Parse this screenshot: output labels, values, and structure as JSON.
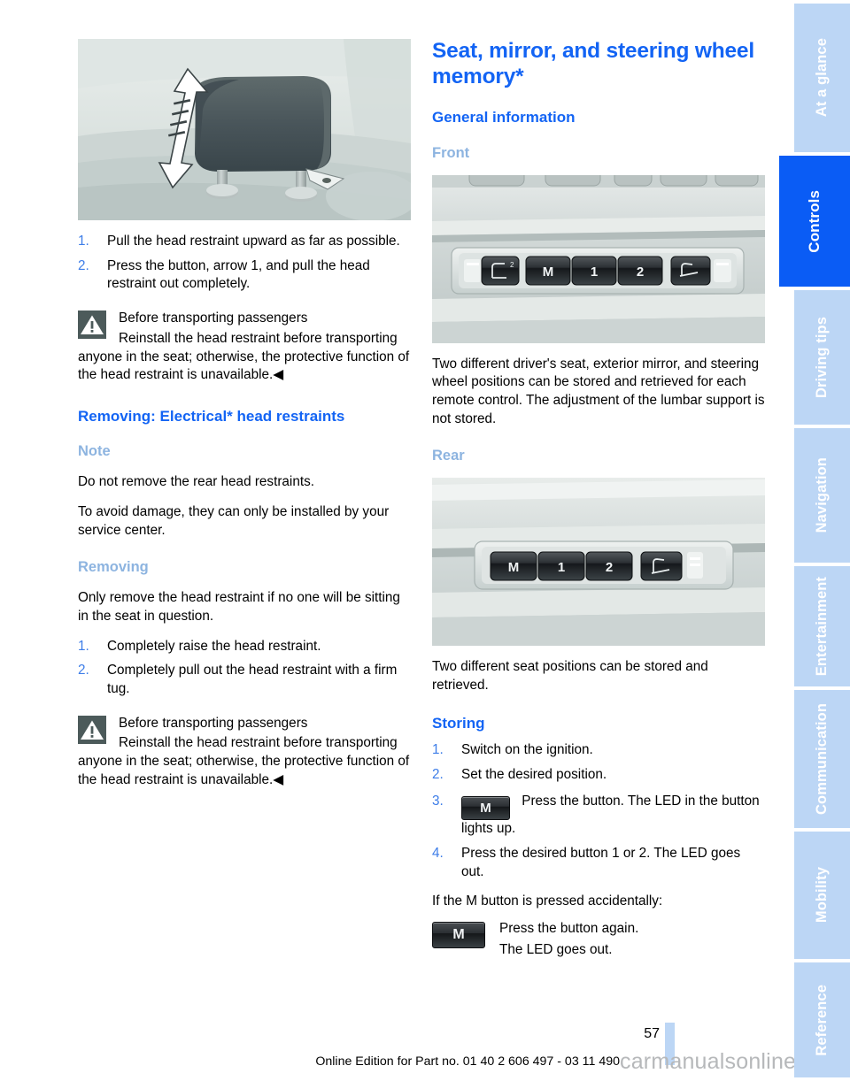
{
  "document": {
    "page_number": "57",
    "footer_note": "Online Edition for Part no. 01 40 2 606 497 - 03 11 490",
    "watermark": "carmanualsonline.info"
  },
  "colors": {
    "heading_blue": "#1364f4",
    "subheading_blue": "#8db4e0",
    "tab_active": "#0a5cf5",
    "tab_inactive": "#bcd6f5",
    "step_number": "#3d7de8",
    "warning_box": "#4c5a5a"
  },
  "sidebar": {
    "tabs": [
      {
        "label": "At a glance",
        "active": false
      },
      {
        "label": "Controls",
        "active": true
      },
      {
        "label": "Driving tips",
        "active": false
      },
      {
        "label": "Navigation",
        "active": false
      },
      {
        "label": "Entertainment",
        "active": false
      },
      {
        "label": "Communication",
        "active": false
      },
      {
        "label": "Mobility",
        "active": false
      },
      {
        "label": "Reference",
        "active": false
      }
    ]
  },
  "left_column": {
    "figure_caption": "Head restraint with up and down adjustment arrow",
    "steps_1": [
      {
        "num": "1.",
        "text": "Pull the head restraint upward as far as pos­sible."
      },
      {
        "num": "2.",
        "text": "Press the button, arrow 1, and pull the head restraint out completely."
      }
    ],
    "warning_1": {
      "title": "Before transporting passengers",
      "body": "Reinstall the head restraint before trans­porting anyone in the seat; otherwise, the pro­tective function of the head restraint is unavail­able.◀"
    },
    "heading_removing_electrical": "Removing: Electrical* head restraints",
    "subheading_note": "Note",
    "note_p1": "Do not remove the rear head restraints.",
    "note_p2": "To avoid damage, they can only be installed by your service center.",
    "subheading_removing": "Removing",
    "removing_intro": "Only remove the head restraint if no one will be sitting in the seat in question.",
    "steps_2": [
      {
        "num": "1.",
        "text": "Completely raise the head restraint."
      },
      {
        "num": "2.",
        "text": "Completely pull out the head restraint with a firm tug."
      }
    ],
    "warning_2": {
      "title": "Before transporting passengers",
      "body": "Reinstall the head restraint before trans­porting anyone in the seat; otherwise, the pro­tective function of the head restraint is unavail­able.◀"
    }
  },
  "right_column": {
    "title": "Seat, mirror, and steering wheel memory*",
    "heading_general": "General information",
    "subheading_front": "Front",
    "front_figure": {
      "caption": "Front door memory button panel",
      "buttons": [
        "seat-backrest-icon",
        "M",
        "1",
        "2",
        "seat-cushion-icon"
      ]
    },
    "front_text": "Two different driver's seat, exterior mirror, and steering wheel positions can be stored and re­trieved for each remote control. The adjustment of the lumbar support is not stored.",
    "subheading_rear": "Rear",
    "rear_figure": {
      "caption": "Rear door memory button panel",
      "buttons": [
        "M",
        "1",
        "2",
        "seat-icon"
      ]
    },
    "rear_text": "Two different seat positions can be stored and retrieved.",
    "heading_storing": "Storing",
    "storing_steps": [
      {
        "num": "1.",
        "text": "Switch on the ignition."
      },
      {
        "num": "2.",
        "text": "Set the desired position."
      },
      {
        "num": "3.",
        "button": "M",
        "text": "Press the button. The LED in the button lights up."
      },
      {
        "num": "4.",
        "text": "Press the desired button 1 or 2. The LED goes out."
      }
    ],
    "accidental_intro": "If the M button is pressed accidentally:",
    "accidental_button": "M",
    "accidental_lines": [
      "Press the button again.",
      "The LED goes out."
    ]
  }
}
